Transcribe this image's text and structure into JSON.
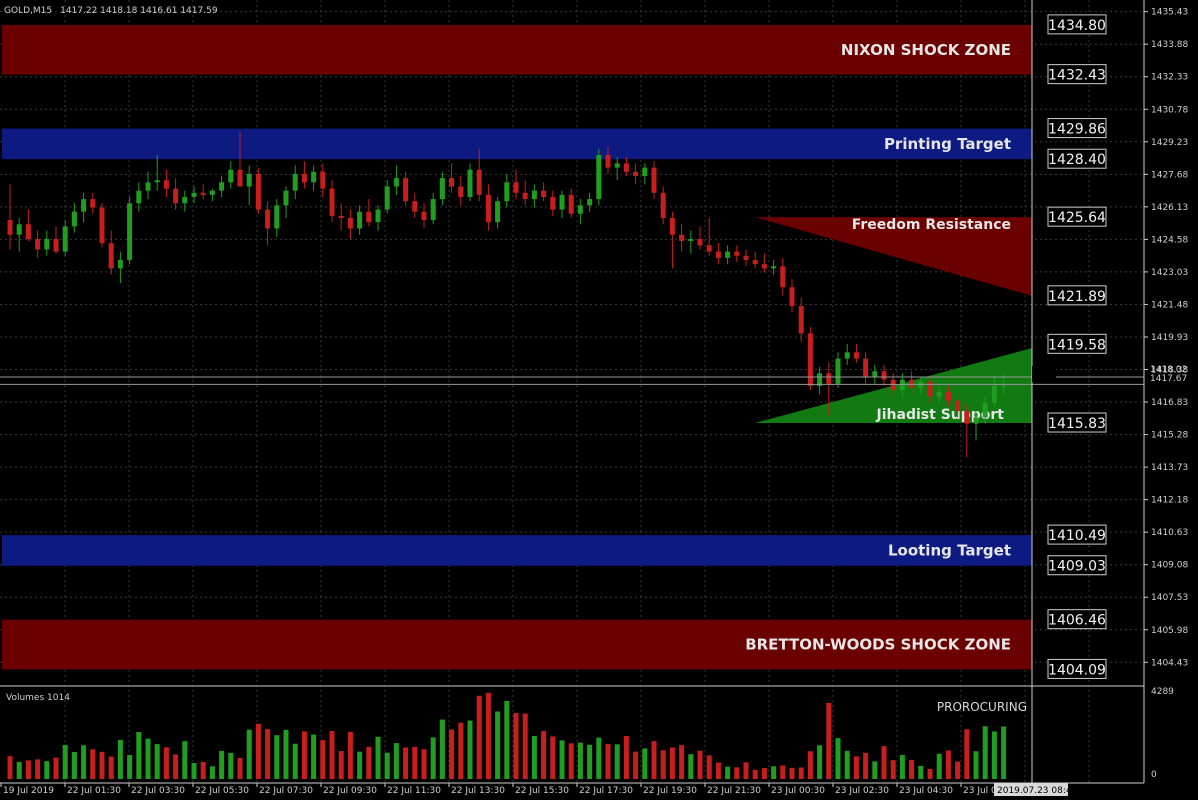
{
  "header": {
    "symbol": "GOLD,M15",
    "ohlc": "1417.22 1418.18 1416.61 1417.59"
  },
  "volume_label": "Volumes 1014",
  "volume_axis": {
    "max_label": "4289",
    "min_label": "0"
  },
  "indicator_text": "PROROCURING",
  "current_prices": {
    "ask": "1418.02",
    "bid": "1417.67"
  },
  "cursor_time": "2019.07.23 08:42",
  "colors": {
    "bull": "#1f9e1f",
    "bear": "#c81e1e",
    "zone_red": "#6b0000",
    "zone_blue": "#0d1a82",
    "grid": "#3a3a3a"
  },
  "zones": [
    {
      "label": "NIXON SHOCK ZONE",
      "from": 1432.43,
      "to": 1434.8,
      "color": "#6b0000"
    },
    {
      "label": "Printing Target",
      "from": 1428.4,
      "to": 1429.86,
      "color": "#0d1a82"
    },
    {
      "label": "Looting Target",
      "from": 1409.03,
      "to": 1410.49,
      "color": "#0d1a82"
    },
    {
      "label": "BRETTON-WOODS SHOCK ZONE",
      "from": 1404.09,
      "to": 1406.46,
      "color": "#6b0000"
    }
  ],
  "triangles": [
    {
      "label": "Freedom Resistance",
      "color": "#6b0000"
    },
    {
      "label": "Jihadist Support",
      "color": "#127a12"
    }
  ],
  "level_labels": [
    "1434.80",
    "1432.43",
    "1429.86",
    "1428.40",
    "1425.64",
    "1421.89",
    "1419.58",
    "1415.83",
    "1410.49",
    "1409.03",
    "1406.46",
    "1404.09"
  ],
  "price_axis_labels": [
    "1435.43",
    "1433.88",
    "1432.33",
    "1430.78",
    "1429.23",
    "1427.68",
    "1426.13",
    "1424.58",
    "1423.03",
    "1421.48",
    "1419.93",
    "1418.38",
    "1416.83",
    "1415.28",
    "1413.73",
    "1412.18",
    "1410.63",
    "1409.08",
    "1407.53",
    "1405.98",
    "1404.43"
  ],
  "time_axis_labels": [
    "19 Jul 2019",
    "22 Jul 01:30",
    "22 Jul 03:30",
    "22 Jul 05:30",
    "22 Jul 07:30",
    "22 Jul 09:30",
    "22 Jul 11:30",
    "22 Jul 13:30",
    "22 Jul 15:30",
    "22 Jul 17:30",
    "22 Jul 19:30",
    "22 Jul 21:30",
    "23 Jul 00:30",
    "23 Jul 02:30",
    "23 Jul 04:30",
    "23 Jul 06:30"
  ],
  "chart_data": {
    "type": "candlestick",
    "price_range": [
      1403.3,
      1435.7
    ],
    "volume_max": 4289,
    "candles": [
      [
        1425.5,
        1427.2,
        1424.1,
        1424.8
      ],
      [
        1424.8,
        1425.6,
        1424.0,
        1425.3
      ],
      [
        1425.3,
        1426.0,
        1424.5,
        1424.6
      ],
      [
        1424.6,
        1425.0,
        1423.7,
        1424.1
      ],
      [
        1424.1,
        1425.0,
        1423.8,
        1424.6
      ],
      [
        1424.6,
        1425.2,
        1423.9,
        1424.0
      ],
      [
        1424.0,
        1425.5,
        1423.8,
        1425.2
      ],
      [
        1425.2,
        1426.3,
        1424.9,
        1425.9
      ],
      [
        1425.9,
        1426.8,
        1425.4,
        1426.5
      ],
      [
        1426.5,
        1426.8,
        1425.8,
        1426.1
      ],
      [
        1426.1,
        1426.3,
        1424.2,
        1424.4
      ],
      [
        1424.4,
        1425.0,
        1422.9,
        1423.2
      ],
      [
        1423.2,
        1424.0,
        1422.5,
        1423.6
      ],
      [
        1423.6,
        1426.6,
        1423.4,
        1426.3
      ],
      [
        1426.3,
        1427.3,
        1425.9,
        1426.9
      ],
      [
        1426.9,
        1427.8,
        1426.5,
        1427.3
      ],
      [
        1427.3,
        1428.6,
        1426.9,
        1427.4
      ],
      [
        1427.4,
        1427.9,
        1426.6,
        1427.0
      ],
      [
        1427.0,
        1427.5,
        1426.0,
        1426.3
      ],
      [
        1426.3,
        1426.9,
        1425.9,
        1426.6
      ],
      [
        1426.6,
        1427.1,
        1426.3,
        1426.8
      ],
      [
        1426.8,
        1427.2,
        1426.5,
        1426.7
      ],
      [
        1426.7,
        1427.0,
        1426.4,
        1426.9
      ],
      [
        1426.9,
        1427.6,
        1426.6,
        1427.3
      ],
      [
        1427.3,
        1428.3,
        1427.0,
        1427.9
      ],
      [
        1427.9,
        1429.7,
        1427.5,
        1427.1
      ],
      [
        1427.1,
        1428.1,
        1426.2,
        1427.7
      ],
      [
        1427.7,
        1428.0,
        1425.8,
        1426.0
      ],
      [
        1426.0,
        1426.4,
        1424.3,
        1425.1
      ],
      [
        1425.1,
        1426.5,
        1424.7,
        1426.2
      ],
      [
        1426.2,
        1427.1,
        1425.6,
        1426.9
      ],
      [
        1426.9,
        1428.1,
        1426.5,
        1427.7
      ],
      [
        1427.7,
        1428.3,
        1427.0,
        1427.3
      ],
      [
        1427.3,
        1428.1,
        1426.9,
        1427.8
      ],
      [
        1427.8,
        1428.2,
        1426.6,
        1427.0
      ],
      [
        1427.0,
        1427.4,
        1425.4,
        1425.7
      ],
      [
        1425.7,
        1426.3,
        1425.0,
        1425.6
      ],
      [
        1425.6,
        1426.0,
        1424.6,
        1425.1
      ],
      [
        1425.1,
        1426.2,
        1424.8,
        1425.9
      ],
      [
        1425.9,
        1426.5,
        1425.2,
        1425.4
      ],
      [
        1425.4,
        1426.2,
        1425.0,
        1426.0
      ],
      [
        1426.0,
        1427.4,
        1425.8,
        1427.1
      ],
      [
        1427.1,
        1428.1,
        1426.7,
        1427.5
      ],
      [
        1427.5,
        1427.8,
        1426.2,
        1426.4
      ],
      [
        1426.4,
        1426.8,
        1425.6,
        1425.9
      ],
      [
        1425.9,
        1426.3,
        1425.1,
        1425.5
      ],
      [
        1425.5,
        1426.8,
        1425.3,
        1426.5
      ],
      [
        1426.5,
        1427.8,
        1426.2,
        1427.5
      ],
      [
        1427.5,
        1428.2,
        1426.8,
        1427.1
      ],
      [
        1427.1,
        1427.6,
        1426.2,
        1426.6
      ],
      [
        1426.6,
        1428.2,
        1426.4,
        1427.9
      ],
      [
        1427.9,
        1428.9,
        1426.4,
        1426.7
      ],
      [
        1426.7,
        1427.2,
        1425.0,
        1425.4
      ],
      [
        1425.4,
        1426.6,
        1425.1,
        1426.4
      ],
      [
        1426.4,
        1427.7,
        1426.1,
        1427.3
      ],
      [
        1427.3,
        1427.9,
        1426.5,
        1426.8
      ],
      [
        1426.8,
        1427.4,
        1426.2,
        1426.5
      ],
      [
        1426.5,
        1427.2,
        1426.1,
        1426.9
      ],
      [
        1426.9,
        1427.3,
        1426.4,
        1426.6
      ],
      [
        1426.6,
        1426.9,
        1425.7,
        1426.0
      ],
      [
        1426.0,
        1426.9,
        1425.6,
        1426.7
      ],
      [
        1426.7,
        1427.0,
        1425.6,
        1425.8
      ],
      [
        1425.8,
        1426.5,
        1425.3,
        1426.2
      ],
      [
        1426.2,
        1426.8,
        1425.9,
        1426.5
      ],
      [
        1426.5,
        1428.9,
        1426.2,
        1428.6
      ],
      [
        1428.6,
        1429.0,
        1427.7,
        1428.0
      ],
      [
        1428.0,
        1428.5,
        1427.4,
        1428.2
      ],
      [
        1428.2,
        1428.5,
        1427.6,
        1427.8
      ],
      [
        1427.8,
        1428.2,
        1427.2,
        1427.6
      ],
      [
        1427.6,
        1428.2,
        1427.2,
        1428.0
      ],
      [
        1428.0,
        1428.3,
        1426.5,
        1426.8
      ],
      [
        1426.8,
        1427.1,
        1425.3,
        1425.6
      ],
      [
        1425.6,
        1425.9,
        1423.2,
        1424.8
      ],
      [
        1424.8,
        1425.3,
        1424.0,
        1424.5
      ],
      [
        1424.5,
        1425.0,
        1423.9,
        1424.6
      ],
      [
        1424.6,
        1425.2,
        1424.1,
        1424.3
      ],
      [
        1424.3,
        1425.6,
        1423.8,
        1424.0
      ],
      [
        1424.0,
        1424.4,
        1423.4,
        1423.7
      ],
      [
        1423.7,
        1424.3,
        1423.4,
        1424.0
      ],
      [
        1424.0,
        1424.3,
        1423.5,
        1423.8
      ],
      [
        1423.8,
        1424.1,
        1423.3,
        1423.6
      ],
      [
        1423.6,
        1424.0,
        1423.2,
        1423.4
      ],
      [
        1423.4,
        1423.9,
        1423.0,
        1423.2
      ],
      [
        1423.2,
        1423.6,
        1422.9,
        1423.3
      ],
      [
        1423.3,
        1423.7,
        1421.9,
        1422.3
      ],
      [
        1422.3,
        1422.7,
        1421.1,
        1421.4
      ],
      [
        1421.4,
        1421.8,
        1419.7,
        1420.1
      ],
      [
        1420.1,
        1420.4,
        1417.4,
        1417.6
      ],
      [
        1417.6,
        1418.5,
        1417.2,
        1418.2
      ],
      [
        1418.2,
        1418.7,
        1416.2,
        1417.7
      ],
      [
        1417.7,
        1419.2,
        1417.5,
        1418.9
      ],
      [
        1418.9,
        1419.6,
        1418.6,
        1419.2
      ],
      [
        1419.2,
        1419.6,
        1418.7,
        1418.9
      ],
      [
        1418.9,
        1419.2,
        1417.7,
        1418.0
      ],
      [
        1418.0,
        1418.6,
        1417.7,
        1418.3
      ],
      [
        1418.3,
        1418.6,
        1417.6,
        1417.9
      ],
      [
        1417.9,
        1418.2,
        1417.1,
        1417.4
      ],
      [
        1417.4,
        1418.2,
        1417.1,
        1417.9
      ],
      [
        1417.9,
        1418.3,
        1417.2,
        1417.5
      ],
      [
        1417.5,
        1418.0,
        1417.2,
        1417.8
      ],
      [
        1417.8,
        1418.0,
        1416.8,
        1417.1
      ],
      [
        1417.1,
        1417.6,
        1416.8,
        1417.3
      ],
      [
        1417.3,
        1417.6,
        1416.6,
        1416.9
      ],
      [
        1416.9,
        1417.2,
        1416.1,
        1416.4
      ],
      [
        1416.4,
        1416.7,
        1414.2,
        1415.8
      ],
      [
        1415.8,
        1416.4,
        1415.0,
        1416.1
      ],
      [
        1416.1,
        1417.1,
        1415.8,
        1416.8
      ],
      [
        1416.8,
        1418.0,
        1416.6,
        1417.6
      ],
      [
        1417.6,
        1418.2,
        1417.2,
        1417.6
      ]
    ],
    "volumes": [
      1150,
      860,
      940,
      990,
      900,
      1080,
      1720,
      1360,
      1700,
      1500,
      1370,
      1130,
      1970,
      1210,
      2370,
      2040,
      1760,
      1600,
      1240,
      1910,
      810,
      860,
      640,
      1420,
      1320,
      1060,
      2490,
      2790,
      2520,
      2210,
      2480,
      1780,
      2400,
      2240,
      1960,
      2420,
      1410,
      2380,
      1380,
      1620,
      2130,
      1330,
      1810,
      1590,
      1620,
      1500,
      2100,
      3000,
      2500,
      2840,
      2950,
      4200,
      4350,
      3410,
      3940,
      3330,
      3300,
      2170,
      2420,
      2150,
      1950,
      1800,
      1840,
      1730,
      2090,
      1770,
      1750,
      2170,
      1380,
      1540,
      1910,
      1450,
      1590,
      1710,
      1250,
      1430,
      1190,
      830,
      620,
      590,
      840,
      460,
      550,
      640,
      680,
      560,
      580,
      1400,
      1700,
      3840,
      2060,
      1420,
      1140,
      1320,
      890,
      1660,
      950,
      1210,
      960,
      660,
      510,
      1270,
      1440,
      880,
      2510,
      1400,
      2660,
      2400,
      2650
    ]
  }
}
